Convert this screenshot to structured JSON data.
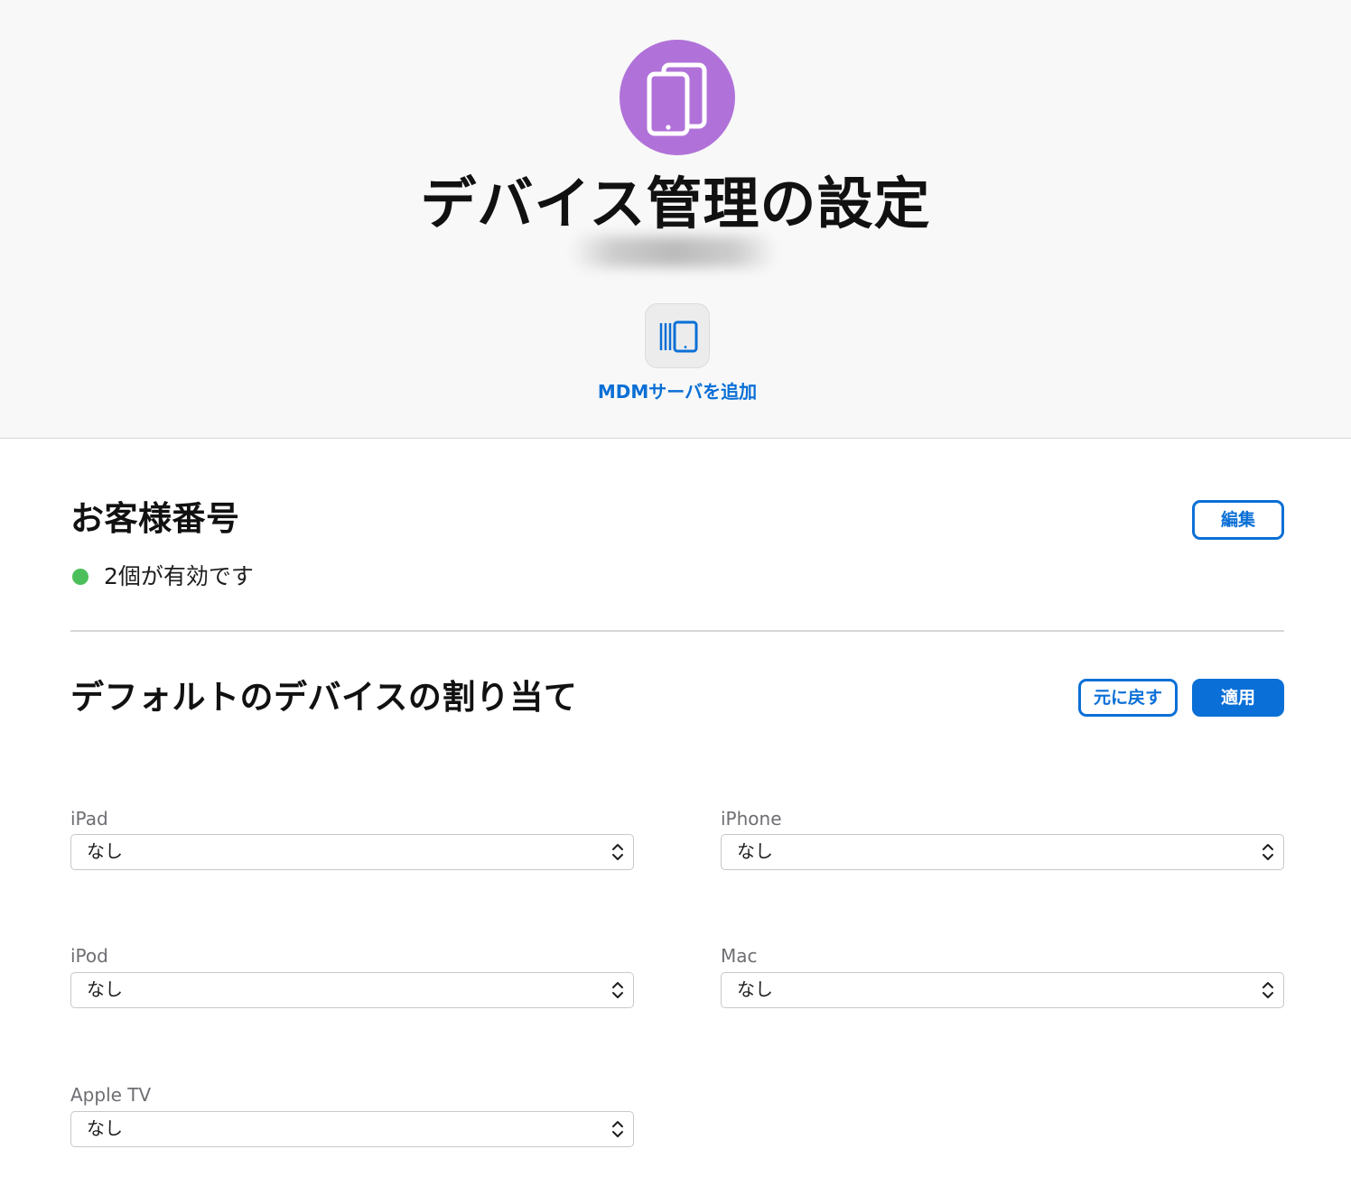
{
  "header": {
    "icon": "ipad-devices-icon",
    "title": "デバイス管理の設定",
    "add_mdm": {
      "icon": "mdm-server-devices-icon",
      "label": "MDMサーバを追加"
    }
  },
  "customer_numbers": {
    "title": "お客様番号",
    "edit_label": "編集",
    "status": {
      "text": "2個が有効です",
      "color": "#4bbf5a"
    }
  },
  "default_assignment": {
    "title": "デフォルトのデバイスの割り当て",
    "revert_label": "元に戻す",
    "apply_label": "適用",
    "fields": {
      "ipad": {
        "label": "iPad",
        "value": "なし"
      },
      "iphone": {
        "label": "iPhone",
        "value": "なし"
      },
      "ipod": {
        "label": "iPod",
        "value": "なし"
      },
      "mac": {
        "label": "Mac",
        "value": "なし"
      },
      "appletv": {
        "label": "Apple TV",
        "value": "なし"
      }
    }
  },
  "colors": {
    "accent": "#0a6fd6",
    "icon_background": "#b072d9",
    "header_background": "#f8f8f8"
  }
}
